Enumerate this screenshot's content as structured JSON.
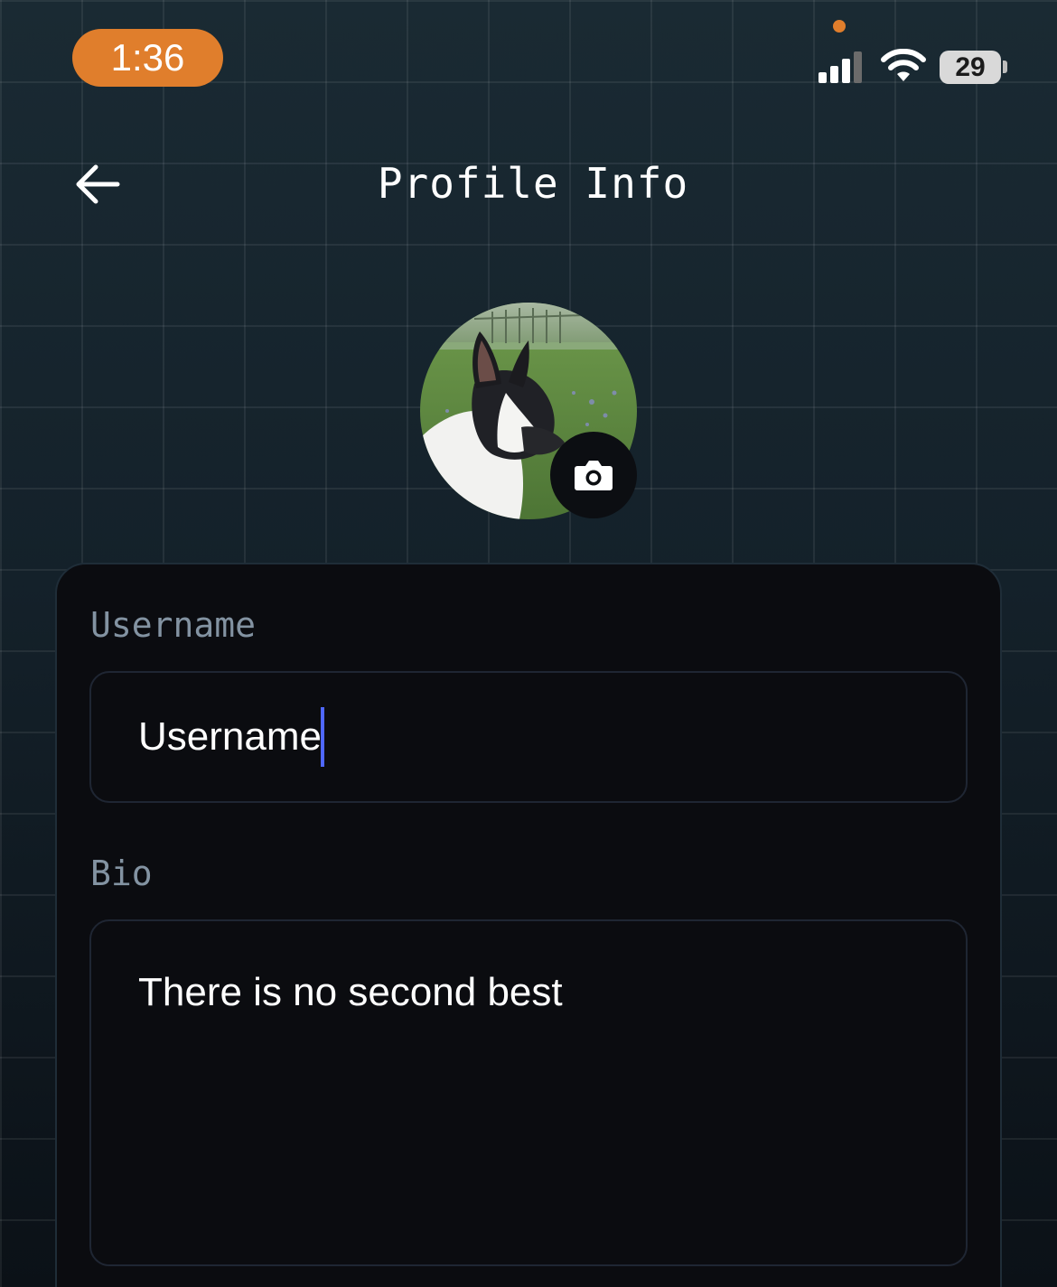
{
  "status_bar": {
    "time": "1:36",
    "battery": "29",
    "accent_color": "#e07e2c"
  },
  "header": {
    "title": "Profile Info",
    "back_icon": "arrow-left-icon"
  },
  "avatar": {
    "description_icon": "camera-icon"
  },
  "form": {
    "username_label": "Username",
    "username_value": "Username",
    "bio_label": "Bio",
    "bio_value": "There is no second best"
  },
  "colors": {
    "caret": "#4f67ff",
    "label": "#8393a2",
    "card_bg": "#0b0c10"
  }
}
